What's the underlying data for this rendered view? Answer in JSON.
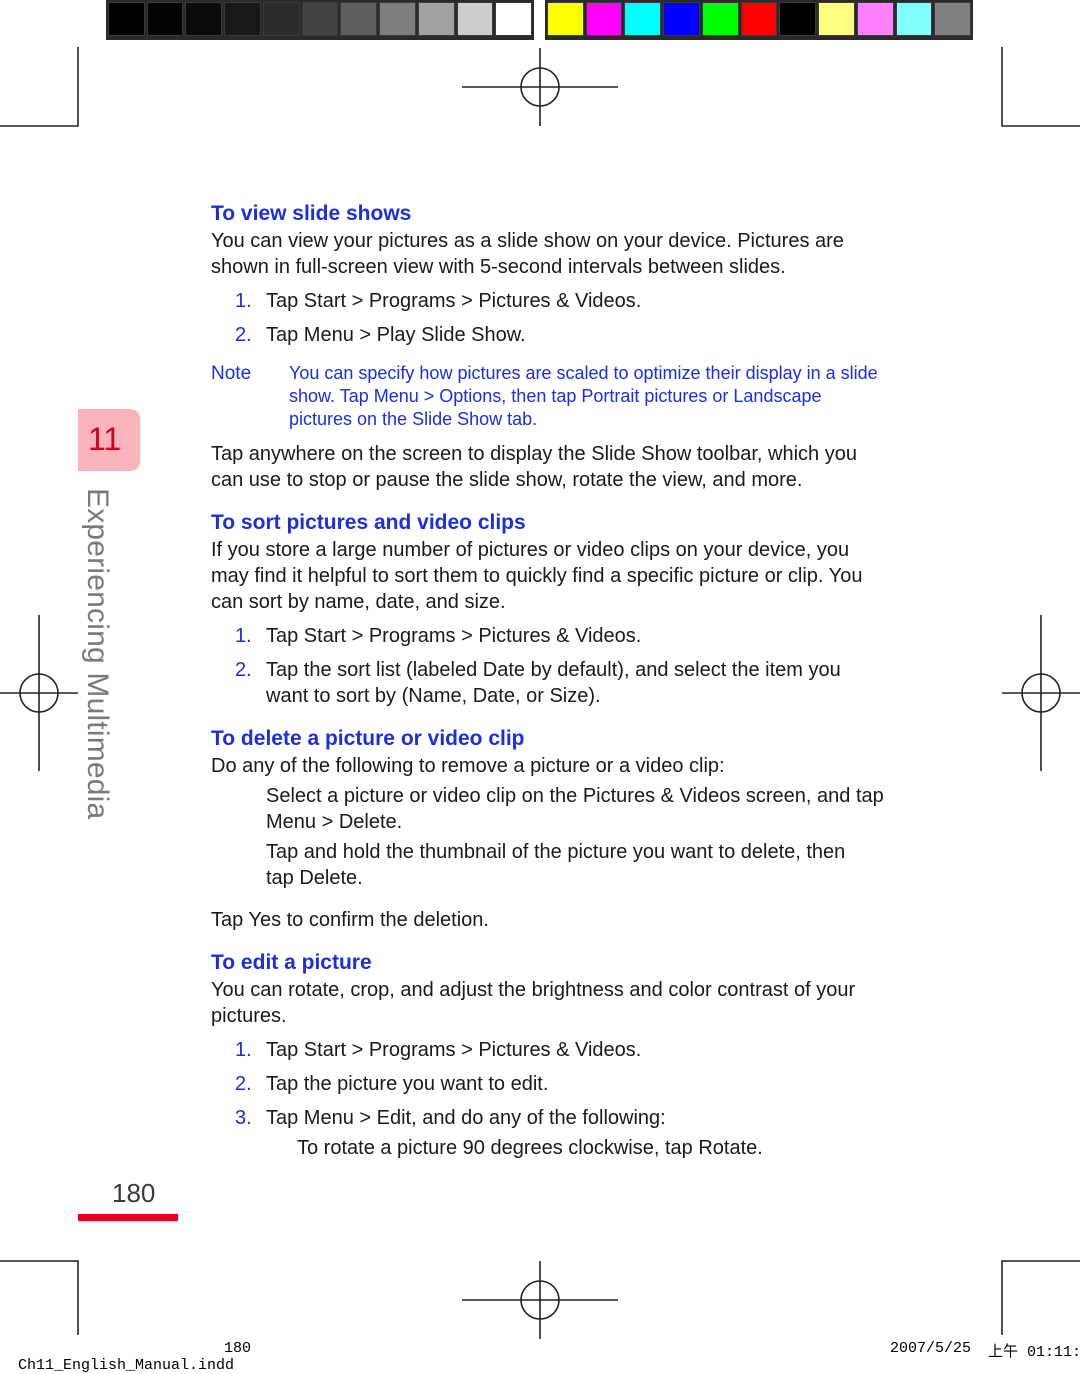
{
  "color_bars": {
    "gray": [
      "#000000",
      "#030303",
      "#0b0b0b",
      "#181818",
      "#2b2b2b",
      "#434343",
      "#5f5f5f",
      "#7e7e7e",
      "#a1a1a1",
      "#cccccc",
      "#ffffff"
    ],
    "color": [
      "#ffff00",
      "#ff00ff",
      "#00ffff",
      "#0000ff",
      "#00ff00",
      "#ff0000",
      "#000000",
      "#ffff80",
      "#ff80ff",
      "#80ffff",
      "#808080"
    ]
  },
  "chapter": {
    "number": "11",
    "title": "Experiencing Multimedia"
  },
  "page_number": "180",
  "sections": {
    "slide_shows": {
      "heading": "To view slide shows",
      "intro_1": "You can view your pictures as a slide show on your device. Pictures are",
      "intro_2": "shown in full-screen view with 5-second intervals between slides.",
      "steps": [
        {
          "num": "1.",
          "text": "Tap Start > Programs > Pictures & Videos."
        },
        {
          "num": "2.",
          "text": "Tap Menu > Play Slide Show."
        }
      ],
      "note_label": "Note",
      "note_1": "You can specify how pictures are scaled to optimize their display in a slide",
      "note_2": "show. Tap Menu > Options, then tap Portrait pictures or Landscape",
      "note_3": "pictures on the Slide Show tab.",
      "outro_1": "Tap anywhere on the screen to display the Slide Show toolbar, which you",
      "outro_2": "can use to stop or pause the slide show, rotate the view, and more."
    },
    "sort": {
      "heading": "To sort pictures and video clips",
      "intro_1": "If you store a large number of pictures or video clips on your device, you",
      "intro_2": "may find it helpful to sort them to quickly find a specific picture or clip. You",
      "intro_3": "can sort by name, date, and size.",
      "steps": [
        {
          "num": "1.",
          "text": "Tap Start > Programs > Pictures & Videos."
        },
        {
          "num": "2.",
          "text_1": "Tap the sort list (labeled Date by default), and select the item you",
          "text_2": "want to sort by (Name, Date, or Size)."
        }
      ]
    },
    "delete": {
      "heading": "To delete a picture or video clip",
      "intro": "Do any of the following to remove a picture or a video clip:",
      "bullets": [
        {
          "line_1": "Select a picture or video clip on the Pictures & Videos screen, and tap",
          "line_2": "Menu > Delete."
        },
        {
          "line_1": "Tap and hold the thumbnail of the picture you want to delete, then",
          "line_2": "tap Delete."
        }
      ],
      "outro": "Tap Yes to confirm the deletion."
    },
    "edit": {
      "heading": "To edit a picture",
      "intro_1": "You can rotate, crop, and adjust the brightness and color contrast of your",
      "intro_2": "pictures.",
      "steps": [
        {
          "num": "1.",
          "text": "Tap Start > Programs > Pictures & Videos."
        },
        {
          "num": "2.",
          "text": "Tap the picture you want to edit."
        },
        {
          "num": "3.",
          "text": "Tap Menu > Edit, and do any of the following:"
        }
      ],
      "sub_bullet": "To rotate a picture 90 degrees clockwise, tap Rotate."
    }
  },
  "footer": {
    "file": "Ch11_English_Manual.indd",
    "page": "180",
    "date": "2007/5/25",
    "time": "上午 01:11:"
  }
}
